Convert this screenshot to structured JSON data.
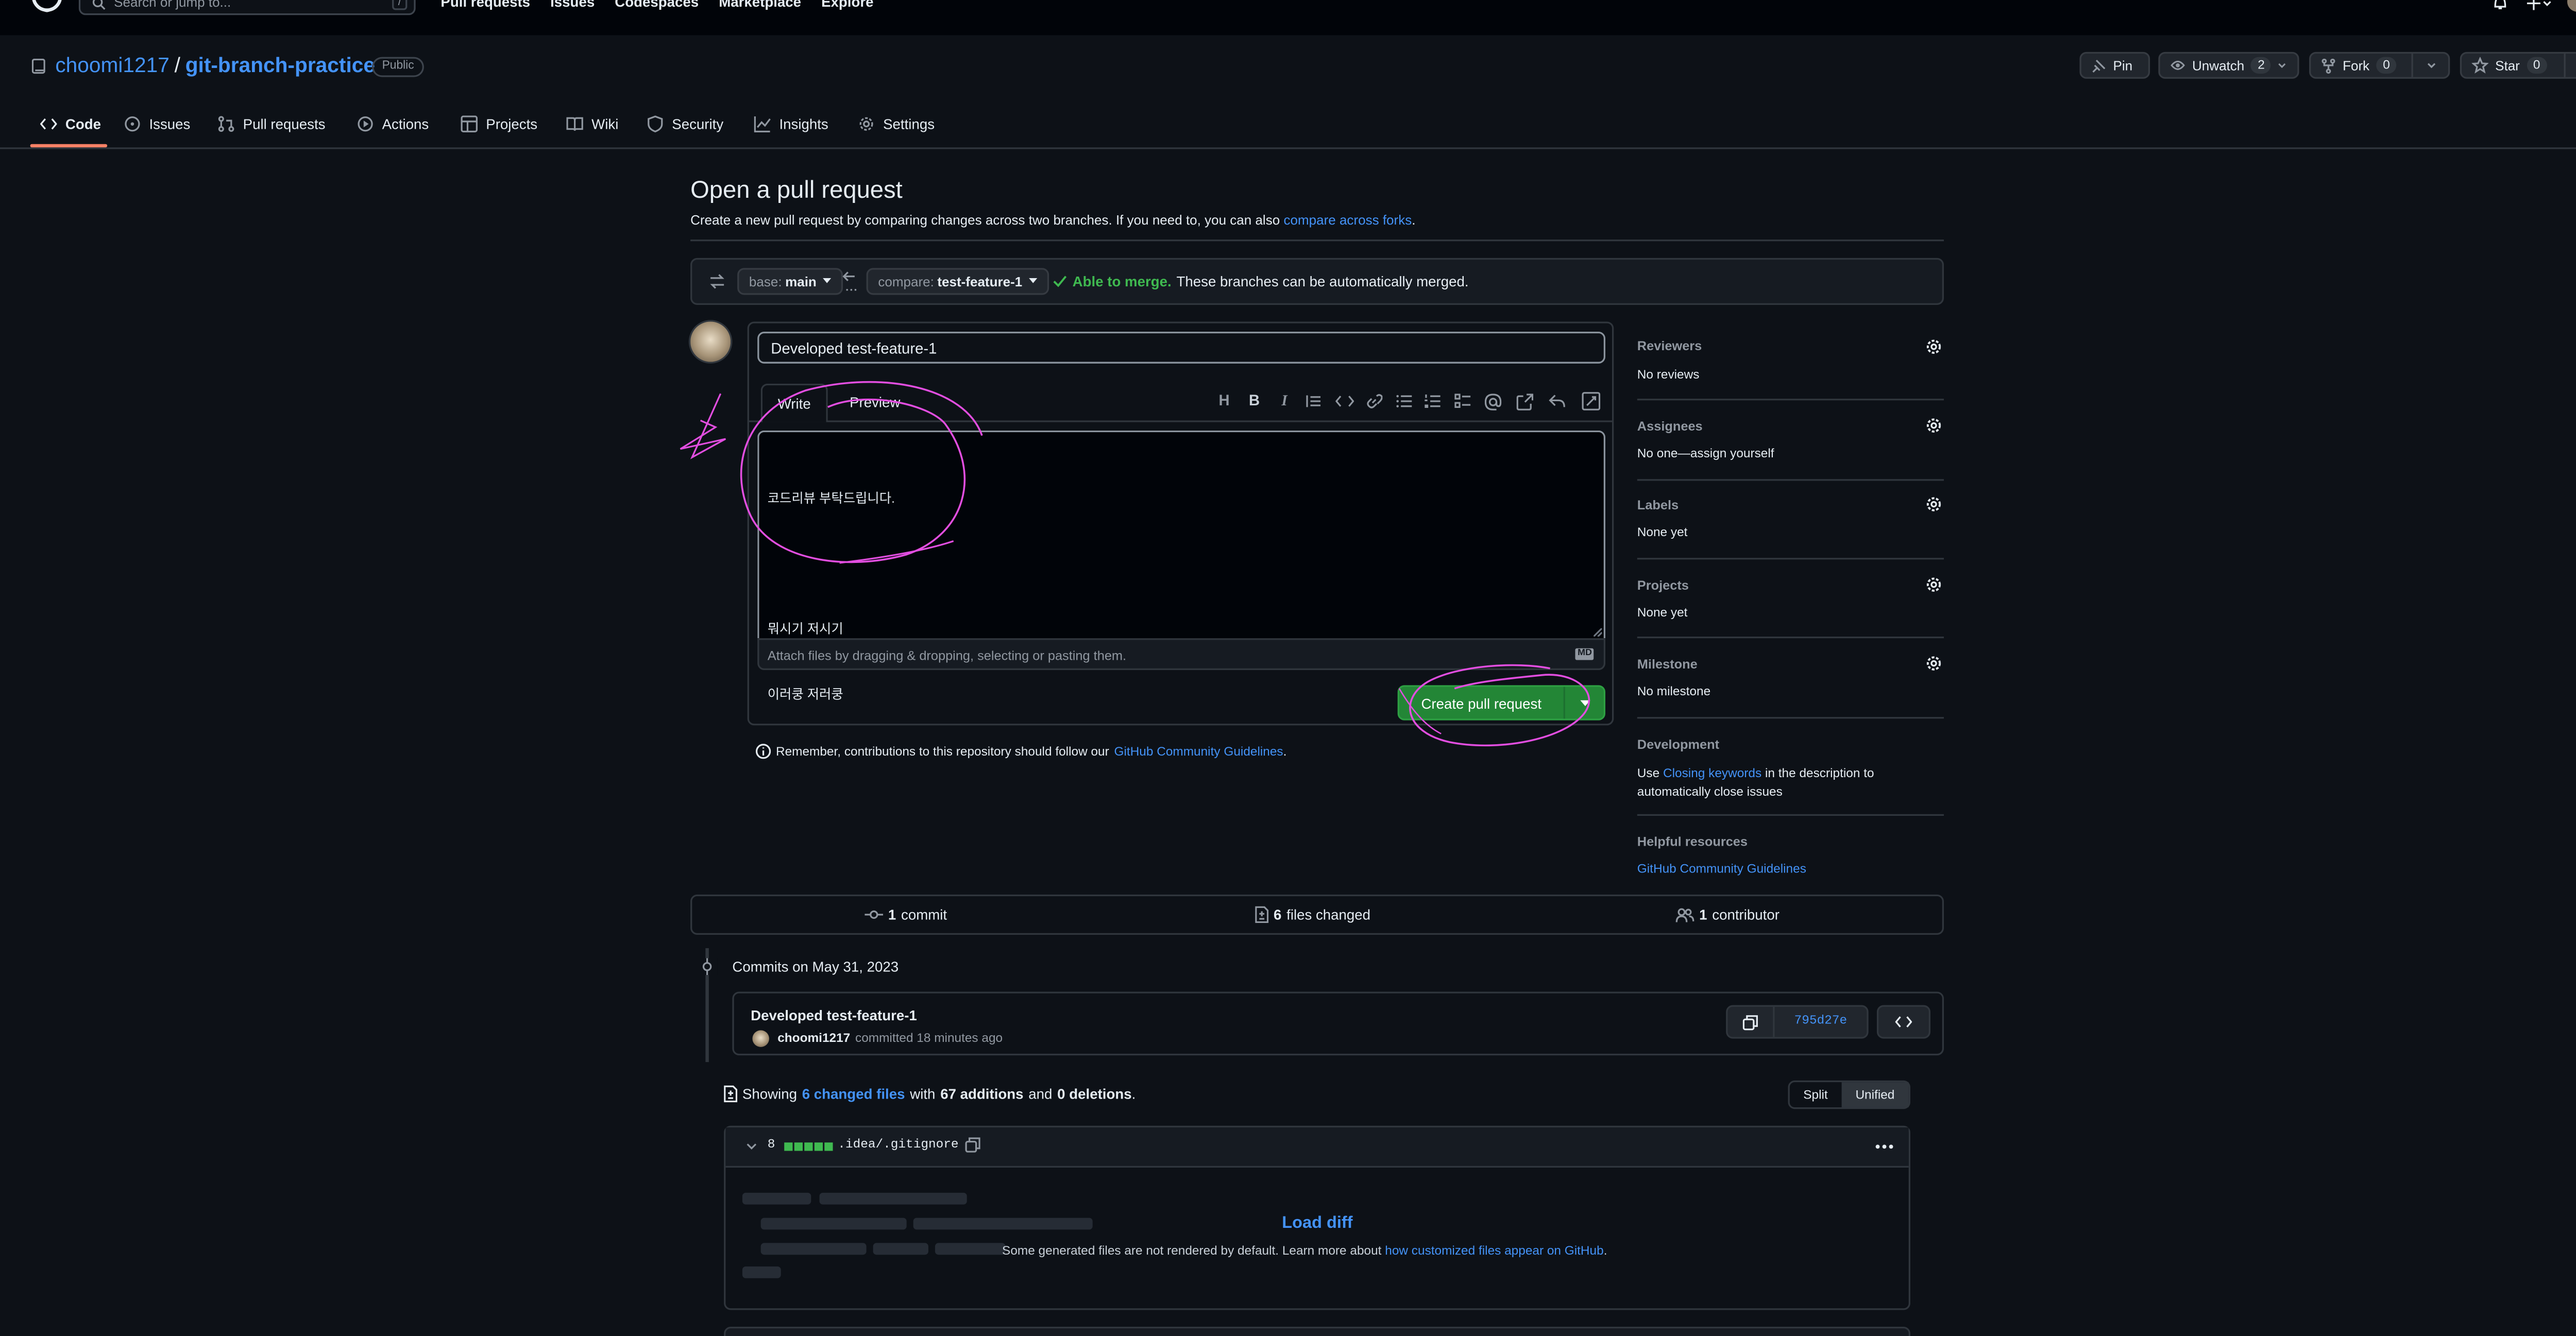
{
  "global_header": {
    "search_placeholder": "Search or jump to...",
    "search_shortcut": "/",
    "nav": [
      "Pull requests",
      "Issues",
      "Codespaces",
      "Marketplace",
      "Explore"
    ]
  },
  "repo": {
    "owner": "choomi1217",
    "slash": "/",
    "name": "git-branch-practice",
    "visibility": "Public",
    "actions": {
      "pin": "Pin",
      "unwatch": "Unwatch",
      "watch_count": "2",
      "fork": "Fork",
      "fork_count": "0",
      "star": "Star",
      "star_count": "0"
    },
    "tabs": [
      "Code",
      "Issues",
      "Pull requests",
      "Actions",
      "Projects",
      "Wiki",
      "Security",
      "Insights",
      "Settings"
    ]
  },
  "page": {
    "title": "Open a pull request",
    "subtitle_prefix": "Create a new pull request by comparing changes across two branches. If you need to, you can also",
    "subtitle_link": "compare across forks",
    "subtitle_suffix": "."
  },
  "compare_bar": {
    "base_label": "base:",
    "base_value": "main",
    "compare_label": "compare:",
    "compare_value": "test-feature-1",
    "merge_status": "Able to merge.",
    "merge_message": "These branches can be automatically merged."
  },
  "form": {
    "title_value": "Developed test-feature-1",
    "tab_write": "Write",
    "tab_preview": "Preview",
    "body_lines": [
      "코드리뷰 부탁드립니다.",
      "",
      "뭐시기 저시기",
      "이러쿵 저러쿵"
    ],
    "attach_text": "Attach files by dragging & dropping, selecting or pasting them.",
    "markdown_badge": "MD",
    "submit_label": "Create pull request",
    "guidelines_prefix": "Remember, contributions to this repository should follow our",
    "guidelines_link": "GitHub Community Guidelines",
    "guidelines_suffix": "."
  },
  "sidebar": {
    "sections": [
      {
        "label": "Reviewers",
        "value": "No reviews"
      },
      {
        "label": "Assignees",
        "value": "No one—assign yourself"
      },
      {
        "label": "Labels",
        "value": "None yet"
      },
      {
        "label": "Projects",
        "value": "None yet"
      },
      {
        "label": "Milestone",
        "value": "No milestone"
      }
    ],
    "development": {
      "label": "Development",
      "text_prefix": "Use",
      "link": "Closing keywords",
      "text_suffix": "in the description to automatically close issues"
    },
    "helpful": {
      "label": "Helpful resources",
      "link": "GitHub Community Guidelines"
    }
  },
  "summary": {
    "commits_count": "1",
    "commits_label": "commit",
    "files_count": "6",
    "files_label": "files changed",
    "contributors_count": "1",
    "contributors_label": "contributor"
  },
  "commits": {
    "date_heading": "Commits on May 31, 2023",
    "message": "Developed test-feature-1",
    "author": "choomi1217",
    "meta": "committed 18 minutes ago",
    "sha": "795d27e"
  },
  "diff": {
    "showing_prefix": "Showing",
    "changed_files_link": "6 changed files",
    "with": "with",
    "additions": "67 additions",
    "and": "and",
    "deletions": "0 deletions",
    "period": ".",
    "view_split": "Split",
    "view_unified": "Unified",
    "file": {
      "changes": "8",
      "path": ".idea/.gitignore",
      "load_label": "Load diff",
      "note_prefix": "Some generated files are not rendered by default. Learn more about",
      "note_link": "how customized files appear on GitHub",
      "note_suffix": "."
    }
  },
  "colors": {
    "background": "#0d1117",
    "header": "#010409",
    "accent_link": "#4493f8",
    "success": "#3fb950",
    "primary_button": "#238636",
    "annotation": "#e24ee0"
  }
}
